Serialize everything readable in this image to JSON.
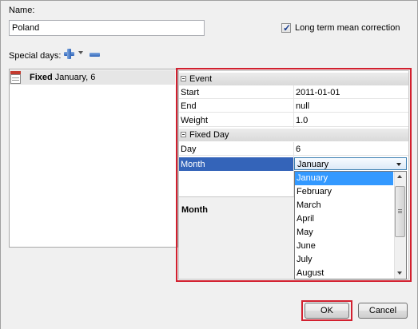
{
  "form": {
    "name_label": "Name:",
    "name_value": "Poland",
    "long_term_label": "Long term mean correction",
    "long_term_checked": true,
    "special_days_label": "Special days:"
  },
  "icons": {
    "add": "plus-icon",
    "menu": "dropdown-arrow-icon",
    "remove": "minus-icon",
    "calendar": "calendar-icon"
  },
  "special_days": [
    {
      "kind": "Fixed",
      "detail": "January, 6"
    }
  ],
  "properties": {
    "event_section": "Event",
    "event_rows": [
      {
        "key": "Start",
        "value": "2011-01-01"
      },
      {
        "key": "End",
        "value": "null"
      },
      {
        "key": "Weight",
        "value": "1.0"
      }
    ],
    "fixed_section": "Fixed Day",
    "fixed_rows": [
      {
        "key": "Day",
        "value": "6"
      },
      {
        "key": "Month",
        "value": "January"
      }
    ],
    "description_title": "Month"
  },
  "month_dropdown": {
    "options": [
      "January",
      "February",
      "March",
      "April",
      "May",
      "June",
      "July",
      "August"
    ],
    "selected": "January"
  },
  "buttons": {
    "ok": "OK",
    "cancel": "Cancel"
  },
  "colors": {
    "highlight": "#3464b9",
    "annotation_red": "#d2202f"
  }
}
